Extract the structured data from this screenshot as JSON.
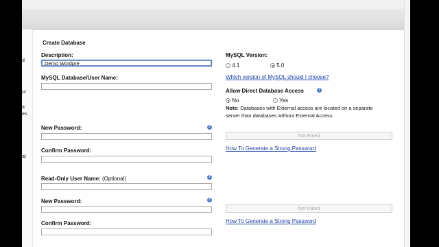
{
  "form": {
    "title": "Create Database",
    "description_label": "Description:",
    "description_value": "Demo Wordpre",
    "mysql_user_label": "MySQL Database/User Name:",
    "new_password_label": "New Password:",
    "confirm_password_label": "Confirm Password:",
    "readonly_user_label": "Read-Only User Name:",
    "readonly_optional": "(Optional)",
    "new_password2_label": "New Password:",
    "confirm_password2_label": "Confirm Password:"
  },
  "right": {
    "mysql_version_label": "MySQL Version:",
    "version_options": [
      "4.1",
      "5.0"
    ],
    "version_selected": "5.0",
    "version_link": "Which version of MySQL should I choose?",
    "direct_access_label": "Allow Direct Database Access",
    "access_options": [
      "No",
      "Yes"
    ],
    "access_selected": "No",
    "note_bold": "Note:",
    "note_text": "Databases with External access are located on a separate server than databases without External Access.",
    "meter1": "Not Rated",
    "strong_pw_link1": "How To Generate a Strong Password",
    "meter2": "Not Rated",
    "strong_pw_link2": "How To Generate a Strong Password"
  },
  "left_fragments": [
    "d",
    "ur",
    "a",
    "es",
    "at"
  ],
  "icons": {
    "help": "help-question-icon"
  },
  "colors": {
    "link": "#1b3fa8",
    "help_icon": "#4d7cc6",
    "active_input_border": "#6e8fc5"
  }
}
